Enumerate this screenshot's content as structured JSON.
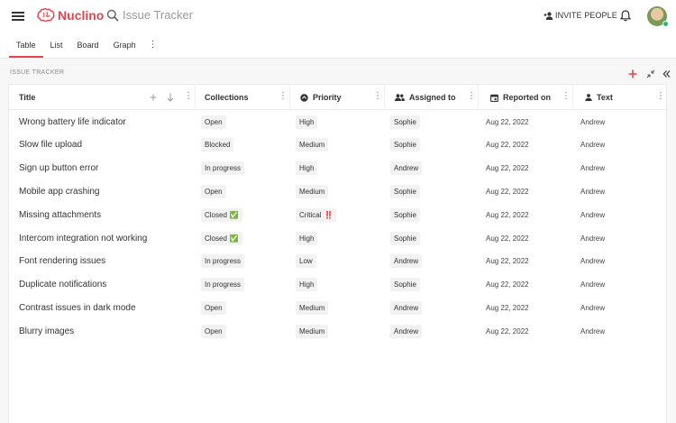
{
  "app": {
    "logo_text": "Nuclino",
    "search_placeholder": "Issue Tracker",
    "invite_label": "INVITE PEOPLE"
  },
  "tabs": [
    {
      "label": "Table",
      "active": true
    },
    {
      "label": "List",
      "active": false
    },
    {
      "label": "Board",
      "active": false
    },
    {
      "label": "Graph",
      "active": false
    }
  ],
  "tabs_more": "⋮",
  "section": {
    "label": "ISSUE TRACKER"
  },
  "columns": {
    "title": "Title",
    "collections": "Collections",
    "priority": "Priority",
    "assigned_to": "Assigned to",
    "reported_on": "Reported on",
    "text": "Text"
  },
  "rows": [
    {
      "title": "Wrong battery life indicator",
      "collection": "Open",
      "collection_emoji": "",
      "priority": "High",
      "priority_emoji": "",
      "assigned": "Sophie",
      "reported": "Aug 22, 2022",
      "text": "Andrew"
    },
    {
      "title": "Slow file upload",
      "collection": "Blocked",
      "collection_emoji": "",
      "priority": "Medium",
      "priority_emoji": "",
      "assigned": "Sophie",
      "reported": "Aug 22, 2022",
      "text": "Andrew"
    },
    {
      "title": "Sign up button error",
      "collection": "In progress",
      "collection_emoji": "",
      "priority": "High",
      "priority_emoji": "",
      "assigned": "Andrew",
      "reported": "Aug 22, 2022",
      "text": "Andrew"
    },
    {
      "title": "Mobile app crashing",
      "collection": "Open",
      "collection_emoji": "",
      "priority": "Medium",
      "priority_emoji": "",
      "assigned": "Sophie",
      "reported": "Aug 22, 2022",
      "text": "Andrew"
    },
    {
      "title": "Missing attachments",
      "collection": "Closed",
      "collection_emoji": "✅",
      "priority": "Critical",
      "priority_emoji": "‼️",
      "assigned": "Sophie",
      "reported": "Aug 22, 2022",
      "text": "Andrew"
    },
    {
      "title": "Intercom integration not working",
      "collection": "Closed",
      "collection_emoji": "✅",
      "priority": "High",
      "priority_emoji": "",
      "assigned": "Sophie",
      "reported": "Aug 22, 2022",
      "text": "Andrew"
    },
    {
      "title": "Font rendering issues",
      "collection": "In progress",
      "collection_emoji": "",
      "priority": "Low",
      "priority_emoji": "",
      "assigned": "Andrew",
      "reported": "Aug 22, 2022",
      "text": "Andrew"
    },
    {
      "title": "Duplicate notifications",
      "collection": "In progress",
      "collection_emoji": "",
      "priority": "High",
      "priority_emoji": "",
      "assigned": "Sophie",
      "reported": "Aug 22, 2022",
      "text": "Andrew"
    },
    {
      "title": "Contrast issues in dark mode",
      "collection": "Open",
      "collection_emoji": "",
      "priority": "Medium",
      "priority_emoji": "",
      "assigned": "Andrew",
      "reported": "Aug 22, 2022",
      "text": "Andrew"
    },
    {
      "title": "Blurry images",
      "collection": "Open",
      "collection_emoji": "",
      "priority": "Medium",
      "priority_emoji": "",
      "assigned": "Andrew",
      "reported": "Aug 22, 2022",
      "text": "Andrew"
    }
  ],
  "colors": {
    "accent": "#e2454f",
    "online": "#35b27a"
  },
  "icons": [
    "menu-icon",
    "brain-logo-icon",
    "search-icon",
    "add-person-icon",
    "bell-icon",
    "plus-icon",
    "collapse-icon",
    "double-chevron-left-icon",
    "sort-down-icon",
    "collection-icon",
    "priority-icon",
    "people-icon",
    "calendar-icon",
    "person-icon",
    "more-vert-icon"
  ]
}
